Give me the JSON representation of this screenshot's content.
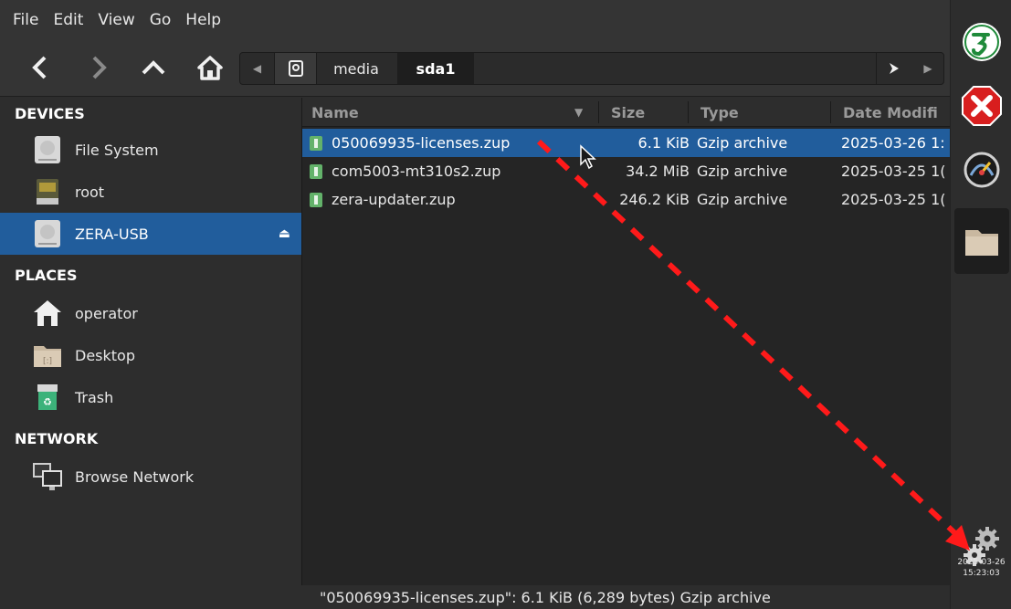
{
  "menu": [
    "File",
    "Edit",
    "View",
    "Go",
    "Help"
  ],
  "toolbar": {
    "back_icon": "chevron-left-icon",
    "forward_icon": "chevron-right-icon",
    "up_icon": "chevron-up-icon",
    "home_icon": "home-icon"
  },
  "pathbar": {
    "root_icon": "drive-icon",
    "crumbs": [
      "media",
      "sda1"
    ]
  },
  "sidebar": {
    "devices_heading": "DEVICES",
    "devices": [
      {
        "label": "File System",
        "icon": "harddisk-icon"
      },
      {
        "label": "root",
        "icon": "drive-icon"
      },
      {
        "label": "ZERA-USB",
        "icon": "harddisk-icon",
        "selected": true
      }
    ],
    "places_heading": "PLACES",
    "places": [
      {
        "label": "operator",
        "icon": "home-icon"
      },
      {
        "label": "Desktop",
        "icon": "folder-icon"
      },
      {
        "label": "Trash",
        "icon": "trash-icon"
      }
    ],
    "network_heading": "NETWORK",
    "network": [
      {
        "label": "Browse Network",
        "icon": "network-icon"
      }
    ]
  },
  "columns": {
    "name": "Name",
    "size": "Size",
    "type": "Type",
    "date": "Date Modifi"
  },
  "files": [
    {
      "name": "050069935-licenses.zup",
      "size": "6.1 KiB",
      "type": "Gzip archive",
      "date": "2025-03-26 1:",
      "selected": true
    },
    {
      "name": "com5003-mt310s2.zup",
      "size": "34.2 MiB",
      "type": "Gzip archive",
      "date": "2025-03-25 1(",
      "selected": false
    },
    {
      "name": "zera-updater.zup",
      "size": "246.2 KiB",
      "type": "Gzip archive",
      "date": "2025-03-25 1(",
      "selected": false
    }
  ],
  "status": "\"050069935-licenses.zup\": 6.1 KiB (6,289 bytes) Gzip archive",
  "dock": {
    "icons": [
      "zera-logo-icon",
      "close-icon",
      "power-meter-icon",
      "folder-icon",
      "gears-icon"
    ],
    "date": "2025-03-26",
    "time": "15:23:03"
  },
  "colors": {
    "selection": "#215d9c",
    "arrow": "#ff1a1a",
    "file_icon": "#63b26a"
  }
}
